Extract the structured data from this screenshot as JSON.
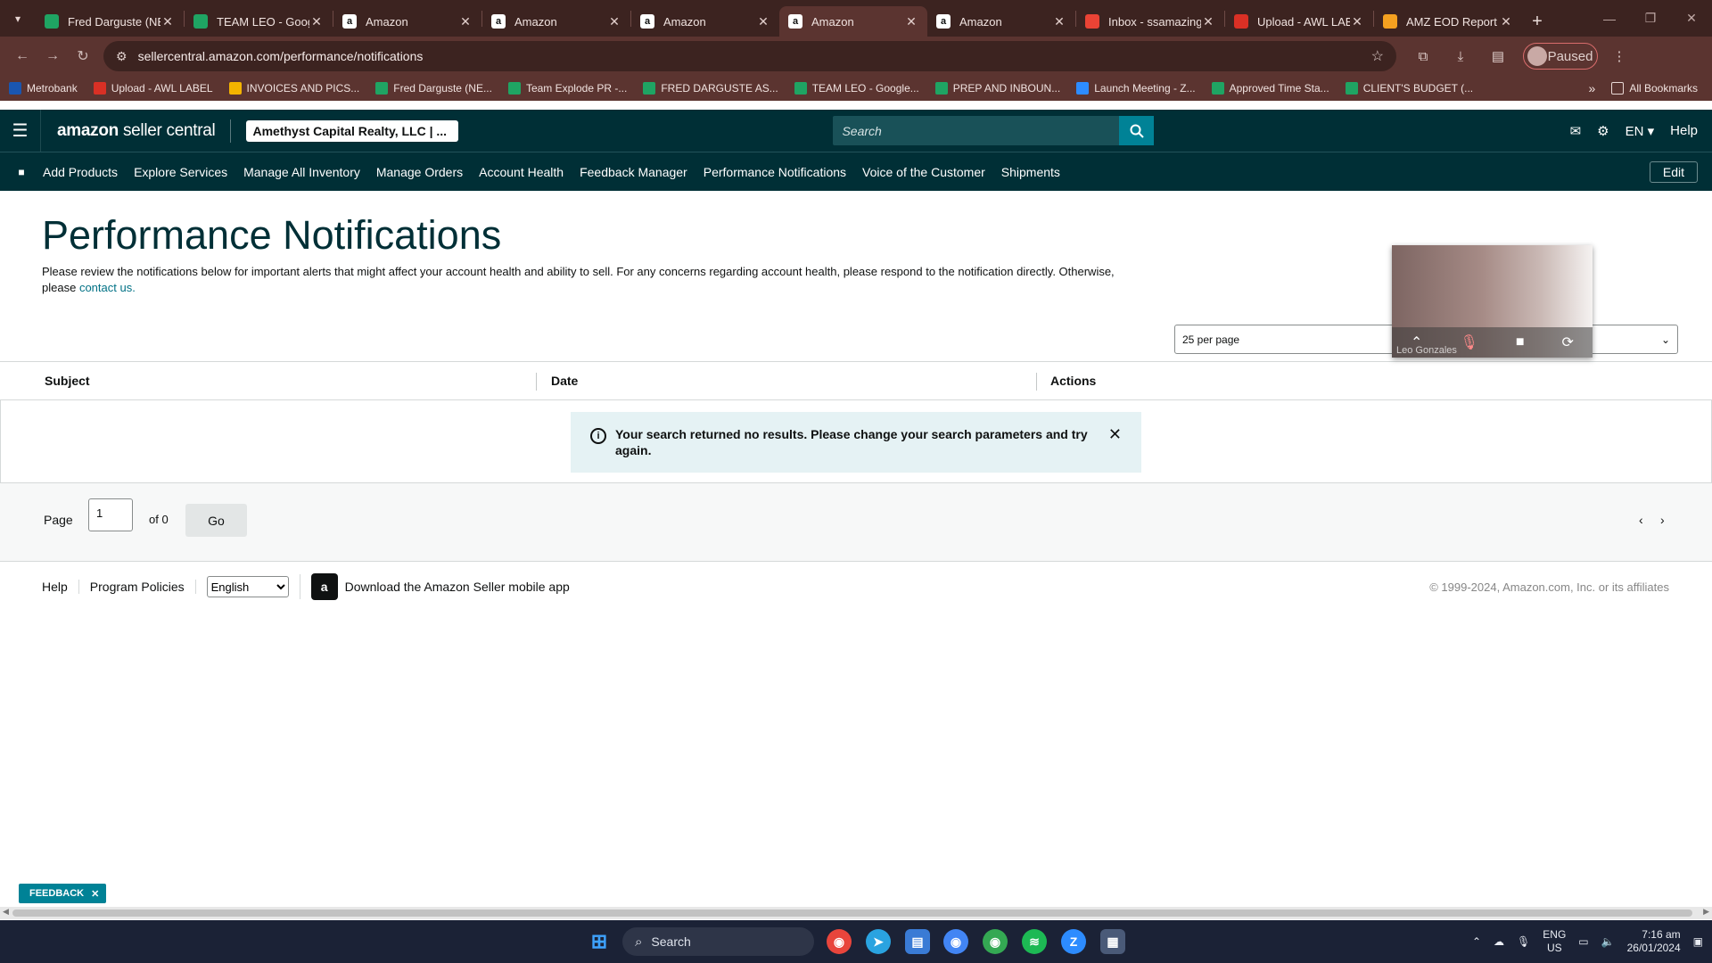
{
  "browser": {
    "tabs": [
      {
        "title": "Fred Darguste (NE",
        "icon": "sheets-icon",
        "color": "#1fa463"
      },
      {
        "title": "TEAM LEO - Goog",
        "icon": "sheets-icon",
        "color": "#1fa463"
      },
      {
        "title": "Amazon",
        "icon": "amazon-icon",
        "color": "#ffffff"
      },
      {
        "title": "Amazon",
        "icon": "amazon-icon",
        "color": "#ffffff"
      },
      {
        "title": "Amazon",
        "icon": "amazon-icon",
        "color": "#ffffff"
      },
      {
        "title": "Amazon",
        "icon": "amazon-icon",
        "color": "#ffffff",
        "active": true
      },
      {
        "title": "Amazon",
        "icon": "amazon-icon",
        "color": "#ffffff"
      },
      {
        "title": "Inbox - ssamazing",
        "icon": "gmail-icon",
        "color": "#ea4335"
      },
      {
        "title": "Upload - AWL LAB",
        "icon": "upload-icon",
        "color": "#d93025"
      },
      {
        "title": "AMZ EOD Report",
        "icon": "report-icon",
        "color": "#f4a020"
      }
    ],
    "url": "sellercentral.amazon.com/performance/notifications",
    "profile_status": "Paused",
    "bookmarks": [
      {
        "label": "Metrobank",
        "color": "#1a56b0"
      },
      {
        "label": "Upload - AWL LABEL",
        "color": "#d93025"
      },
      {
        "label": "INVOICES AND PICS...",
        "color": "#f4b400"
      },
      {
        "label": "Fred Darguste (NE...",
        "color": "#1fa463"
      },
      {
        "label": "Team Explode PR -...",
        "color": "#1fa463"
      },
      {
        "label": "FRED DARGUSTE AS...",
        "color": "#1fa463"
      },
      {
        "label": "TEAM LEO - Google...",
        "color": "#1fa463"
      },
      {
        "label": "PREP AND INBOUN...",
        "color": "#1fa463"
      },
      {
        "label": "Launch Meeting - Z...",
        "color": "#2d8cff"
      },
      {
        "label": "Approved Time Sta...",
        "color": "#1fa463"
      },
      {
        "label": "CLIENT'S BUDGET (...",
        "color": "#1fa463"
      }
    ],
    "all_bookmarks": "All Bookmarks"
  },
  "header": {
    "logo_main": "amazon",
    "logo_sub": "seller central",
    "account": "Amethyst Capital Realty, LLC | ...",
    "search_placeholder": "Search",
    "language": "EN ▾",
    "help": "Help"
  },
  "nav": {
    "items": [
      "Add Products",
      "Explore Services",
      "Manage All Inventory",
      "Manage Orders",
      "Account Health",
      "Feedback Manager",
      "Performance Notifications",
      "Voice of the Customer",
      "Shipments"
    ],
    "edit": "Edit"
  },
  "main": {
    "title": "Performance Notifications",
    "intro_text": "Please review the notifications below for important alerts that might affect your account health and ability to sell. For any concerns regarding account health, please respond to the notification directly. Otherwise, please",
    "intro_link": "contact us.",
    "per_page": "25 per page",
    "columns": [
      "Subject",
      "Date",
      "Actions"
    ],
    "alert": "Your search returned no results. Please change your search parameters and try again.",
    "pager": {
      "label": "Page",
      "value": "1",
      "of": "of 0",
      "go": "Go"
    }
  },
  "video": {
    "name": "Leo Gonzales"
  },
  "footer": {
    "help": "Help",
    "policies": "Program Policies",
    "language": "English",
    "app": "Download the Amazon Seller mobile app",
    "copyright": "© 1999-2024, Amazon.com, Inc. or its affiliates"
  },
  "feedback": "FEEDBACK",
  "taskbar": {
    "search": "Search",
    "lang_top": "ENG",
    "lang_bottom": "US",
    "time": "7:16 am",
    "date": "26/01/2024"
  }
}
